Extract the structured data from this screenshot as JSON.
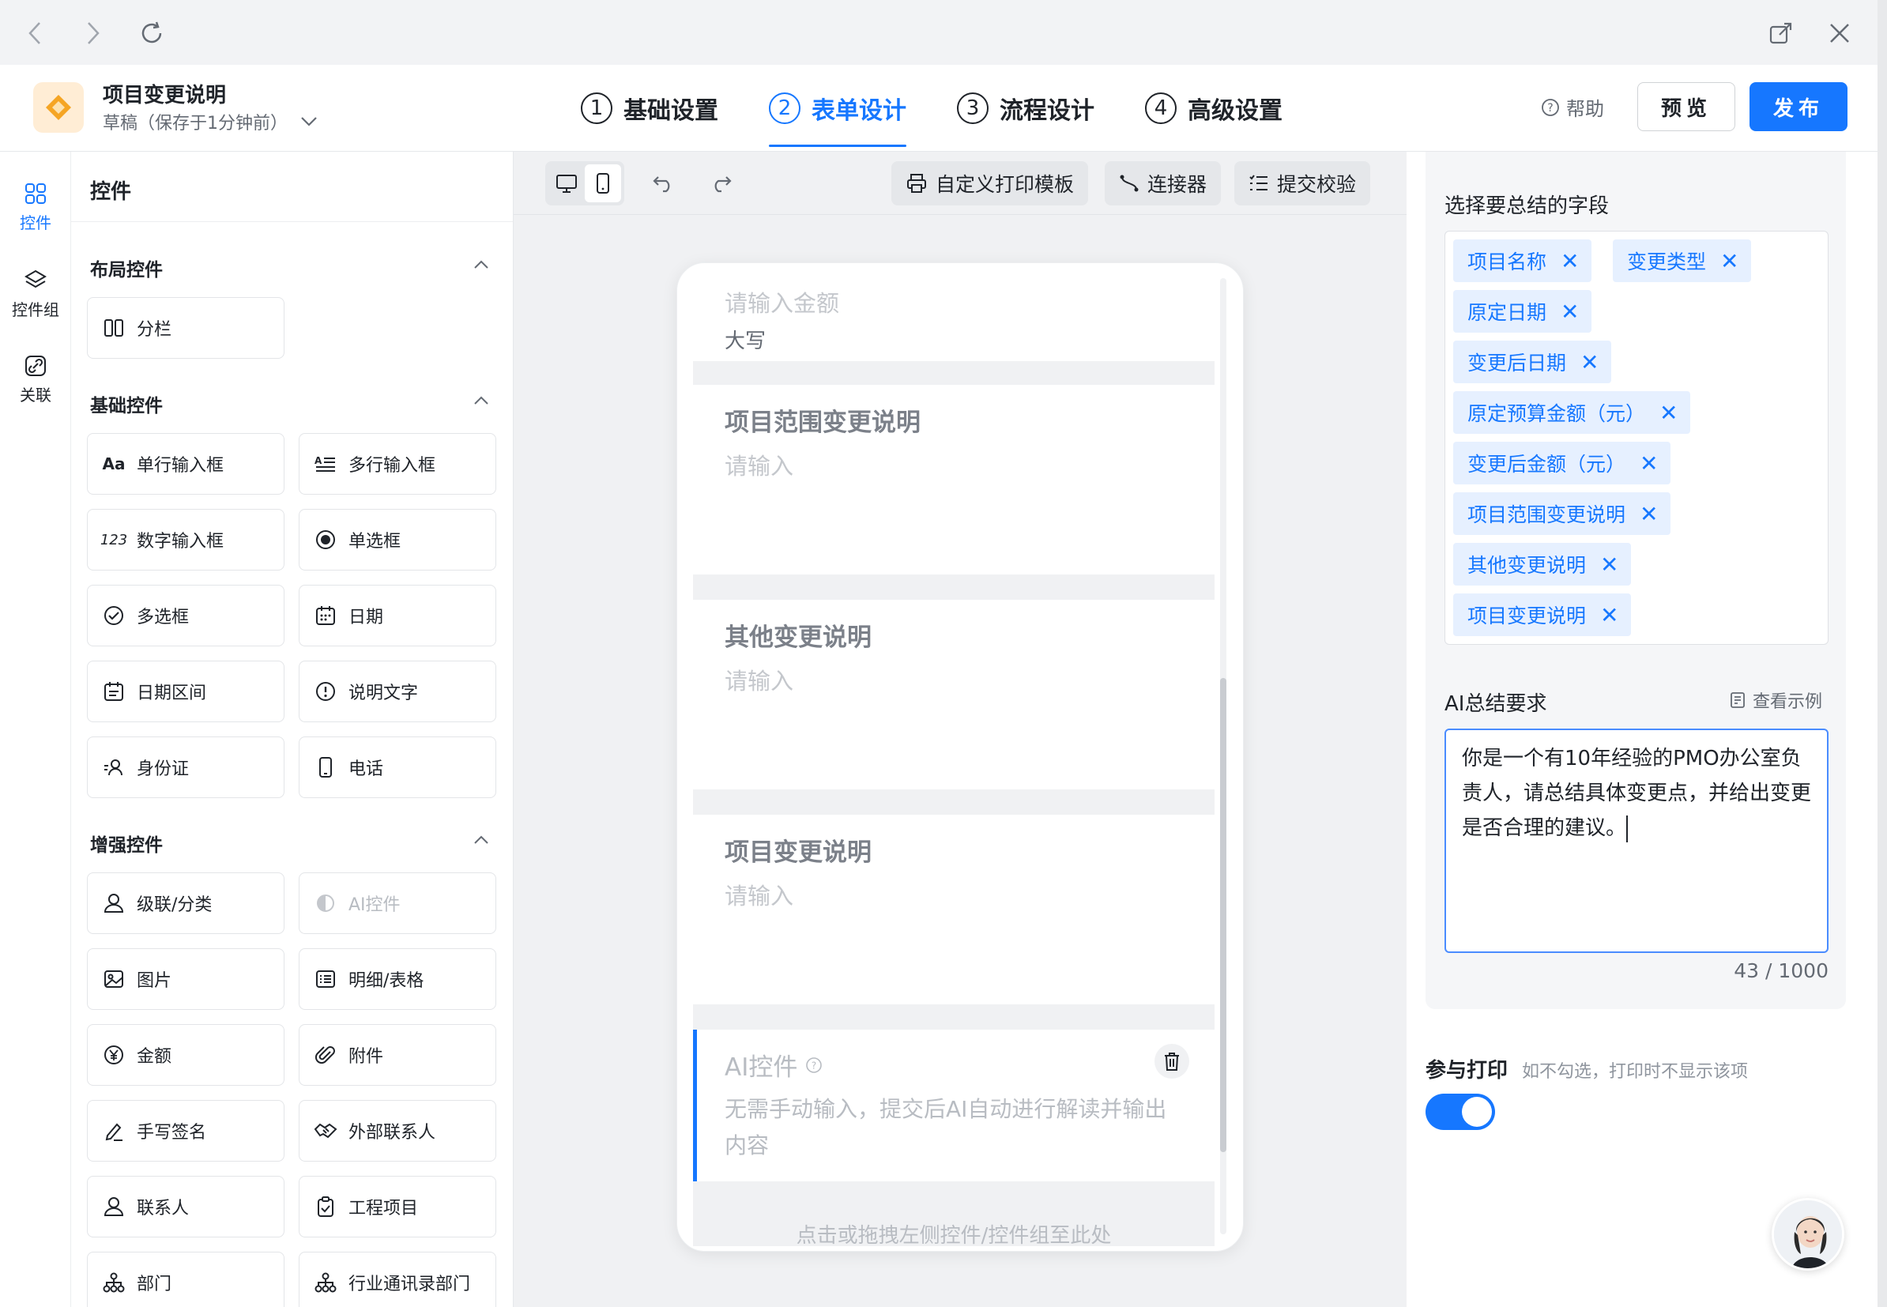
{
  "app": {
    "title": "项目变更说明",
    "draft_status": "草稿（保存于1分钟前）",
    "help_label": "帮助",
    "preview_label": "预览",
    "publish_label": "发布"
  },
  "steps": [
    {
      "num": "1",
      "label": "基础设置"
    },
    {
      "num": "2",
      "label": "表单设计"
    },
    {
      "num": "3",
      "label": "流程设计"
    },
    {
      "num": "4",
      "label": "高级设置"
    }
  ],
  "rail": {
    "components": "控件",
    "groups": "控件组",
    "relations": "关联"
  },
  "panel": {
    "title": "控件",
    "layout_section": "布局控件",
    "basic_section": "基础控件",
    "enhanced_section": "增强控件",
    "layout_items": [
      "分栏"
    ],
    "basic_items": [
      "单行输入框",
      "多行输入框",
      "数字输入框",
      "单选框",
      "多选框",
      "日期",
      "日期区间",
      "说明文字",
      "身份证",
      "电话"
    ],
    "enhanced_items": [
      "级联/分类",
      "AI控件",
      "图片",
      "明细/表格",
      "金额",
      "附件",
      "手写签名",
      "外部联系人",
      "联系人",
      "工程项目",
      "部门",
      "行业通讯录部门"
    ]
  },
  "toolbar": {
    "print_template": "自定义打印模板",
    "connector": "连接器",
    "submit_check": "提交校验"
  },
  "form": {
    "amount_placeholder": "请输入金额",
    "amount_uppercase": "大写",
    "scope_label": "项目范围变更说明",
    "scope_placeholder": "请输入",
    "other_label": "其他变更说明",
    "other_placeholder": "请输入",
    "change_label": "项目变更说明",
    "change_placeholder": "请输入",
    "ai_label": "AI控件",
    "ai_desc": "无需手动输入，提交后AI自动进行解读并输出内容",
    "drop_hint": "点击或拖拽左侧控件/控件组至此处"
  },
  "props": {
    "fields_label": "选择要总结的字段",
    "fields": [
      "项目名称",
      "变更类型",
      "原定日期",
      "变更后日期",
      "原定预算金额（元）",
      "变更后金额（元）",
      "项目范围变更说明",
      "其他变更说明",
      "项目变更说明"
    ],
    "requirement_label": "AI总结要求",
    "view_example": "查看示例",
    "requirement_text": "你是一个有10年经验的PMO办公室负责人，请总结具体变更点，并给出变更是否合理的建议。",
    "counter": "43 / 1000",
    "print_label": "参与打印",
    "print_hint": "如不勾选，打印时不显示该项",
    "print_enabled": true
  },
  "colors": {
    "accent": "#1677ff",
    "tag_bg": "#e6f0ff"
  }
}
